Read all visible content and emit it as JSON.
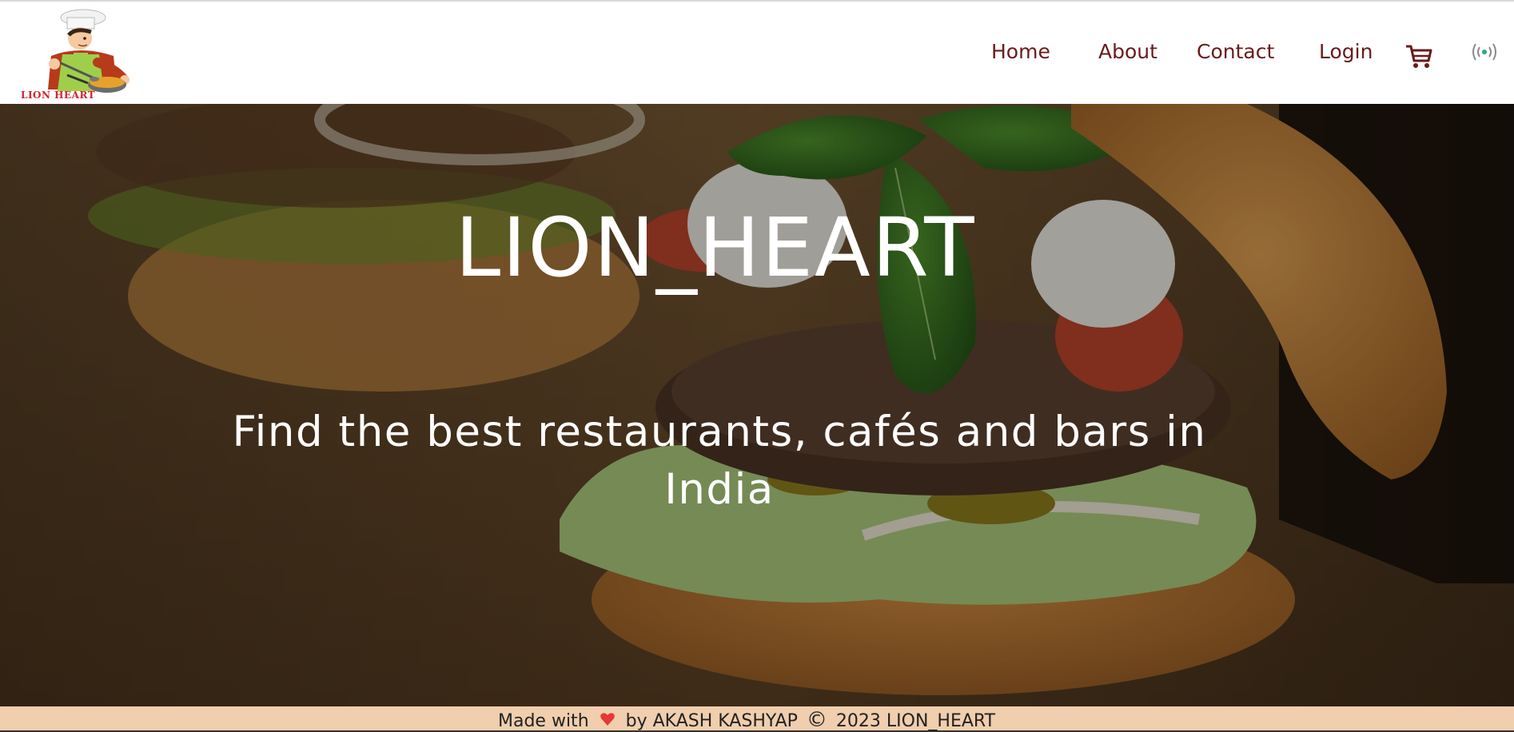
{
  "brand": {
    "logo_text": "LION HEART"
  },
  "nav": {
    "items": [
      {
        "label": "Home"
      },
      {
        "label": "About"
      },
      {
        "label": "Contact"
      },
      {
        "label": "Login"
      }
    ],
    "cart_icon": "shopping-cart-icon",
    "broadcast_icon": "broadcast-icon"
  },
  "hero": {
    "title": "LION_HEART",
    "subtitle": "Find the best restaurants, cafés and bars in India"
  },
  "footer": {
    "made_with": "Made with",
    "by_text": "by AKASH KASHYAP",
    "copyright_symbol": "©",
    "year_brand": "2023 LION_HEART",
    "heart_icon": "heart-icon"
  },
  "colors": {
    "nav_text": "#6a1b1b",
    "footer_bg": "#f0ceae",
    "heart": "#e53935",
    "logo_text": "#d4242d"
  }
}
